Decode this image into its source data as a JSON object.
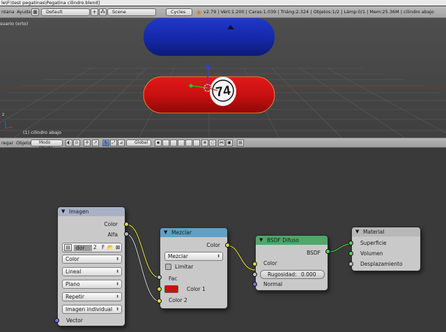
{
  "window": {
    "title": "le\\F:\\test pegatinas\\Pegatina cilindro.blend]"
  },
  "infobar": {
    "menus": [
      "ntana",
      "Ayuda"
    ],
    "layout": "Default",
    "scene": "Scene",
    "engine": "Cycles",
    "stats": "v2.79 | Vért:1.200 | Caras:1.039 | Triáng:2.324 | Objetos:1/2 | Lámp:0/1 | Mem:25.36M | cilindro abajo"
  },
  "viewport": {
    "view_label": "suario (orto)",
    "status": "(1) cilindro abajo",
    "sticker_number": "74",
    "colors": {
      "top_cylinder": "#1a2fb3",
      "bottom_cylinder": "#d01010"
    }
  },
  "header3d": {
    "menus": [
      "regar",
      "Objeto"
    ],
    "mode": "Modo Objeto",
    "orientation": "Global"
  },
  "nodes": {
    "imagen": {
      "title": "Imagen",
      "out_color": "Color",
      "out_alfa": "Alfa",
      "datablock": "dor",
      "users": "2",
      "fake": "F",
      "color_space": "Color",
      "interpolation": "Lineal",
      "projection": "Plano",
      "extension": "Repetir",
      "source": "Imagen individual",
      "in_vector": "Vector"
    },
    "mezclar": {
      "title": "Mezclar",
      "out_color": "Color",
      "blend_type": "Mezclar",
      "clamp": "Limitar",
      "fac": "Fac",
      "color1": "Color 1",
      "color2": "Color 2",
      "color1_value": "#cc1010"
    },
    "bsdf": {
      "title": "BSDF Difuso",
      "out_bsdf": "BSDF",
      "in_color": "Color",
      "roughness_label": "Rugosidad:",
      "roughness_value": "0.000",
      "in_normal": "Normal"
    },
    "material": {
      "title": "Material",
      "surface": "Superficie",
      "volume": "Volumen",
      "displacement": "Desplazamiento"
    }
  }
}
